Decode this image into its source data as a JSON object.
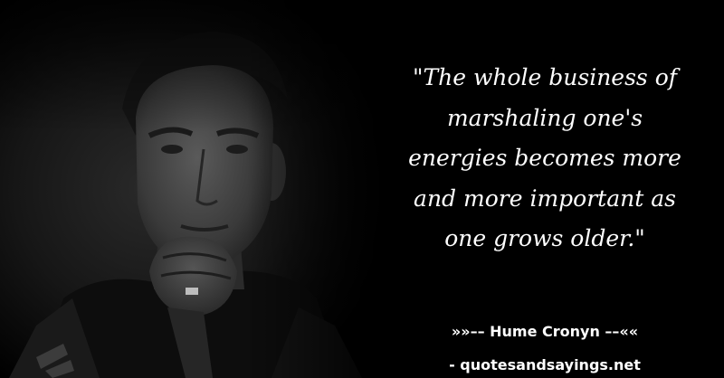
{
  "quote": {
    "text": "\"The whole business of\nmarshaling one's\nenergies becomes more\nand more important as\none grows older.\""
  },
  "author": {
    "line": "»»–– Hume Cronyn ––««"
  },
  "site": {
    "label": "- quotesandsayings.net"
  },
  "photo": {
    "description": "portrait-photo",
    "tone": "grayscale"
  },
  "colors": {
    "background": "#000000",
    "text": "#ffffff"
  }
}
